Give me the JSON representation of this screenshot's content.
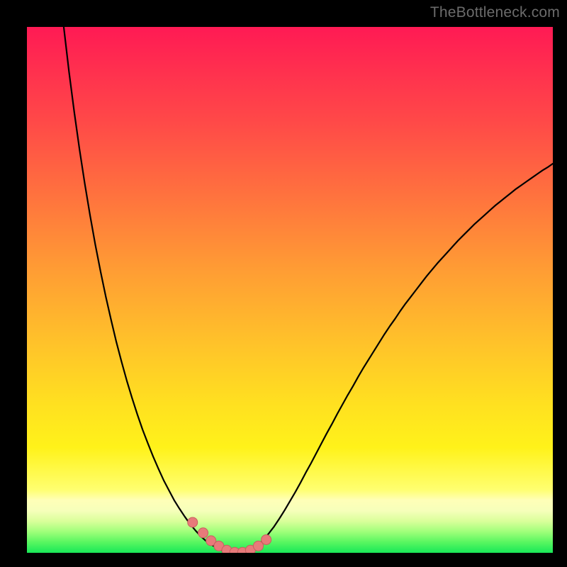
{
  "watermark": "TheBottleneck.com",
  "colors": {
    "frame": "#000000",
    "curve": "#000000",
    "marker_fill": "#e77a7a",
    "marker_stroke": "#c85f5f"
  },
  "chart_data": {
    "type": "line",
    "title": "",
    "xlabel": "",
    "ylabel": "",
    "xlim": [
      0,
      100
    ],
    "ylim": [
      0,
      100
    ],
    "grid": false,
    "x": [
      0,
      1,
      2,
      3,
      4,
      5,
      6,
      7,
      8,
      9,
      10,
      11,
      12,
      13,
      14,
      15,
      16,
      17,
      18,
      19,
      20,
      21,
      22,
      23,
      24,
      25,
      26,
      27,
      28,
      29,
      30,
      31,
      32,
      33,
      34,
      35,
      36,
      37,
      38,
      39,
      40,
      41,
      42,
      43,
      44,
      45,
      46,
      47,
      48,
      49,
      50,
      51,
      52,
      53,
      54,
      55,
      56,
      57,
      58,
      59,
      60,
      61,
      62,
      63,
      64,
      65,
      66,
      67,
      68,
      69,
      70,
      71,
      72,
      73,
      74,
      75,
      76,
      77,
      78,
      79,
      80,
      81,
      82,
      83,
      84,
      85,
      86,
      87,
      88,
      89,
      90,
      91,
      92,
      93,
      94,
      95,
      96,
      97,
      98,
      99,
      100
    ],
    "y": [
      null,
      null,
      null,
      null,
      null,
      null,
      null,
      100.0,
      91.5,
      83.8,
      76.7,
      70.2,
      64.2,
      58.6,
      53.5,
      48.7,
      44.3,
      40.1,
      36.3,
      32.7,
      29.4,
      26.3,
      23.4,
      20.8,
      18.3,
      16.0,
      13.8,
      11.9,
      10.0,
      8.4,
      6.9,
      5.5,
      4.3,
      3.2,
      2.3,
      1.6,
      1.0,
      0.5,
      0.2,
      0.05,
      0.0,
      0.05,
      0.3,
      0.8,
      1.5,
      2.5,
      3.7,
      5.0,
      6.5,
      8.1,
      9.8,
      11.5,
      13.3,
      15.2,
      17.0,
      18.9,
      20.8,
      22.7,
      24.5,
      26.4,
      28.2,
      30.0,
      31.7,
      33.5,
      35.2,
      36.8,
      38.4,
      40.0,
      41.6,
      43.1,
      44.5,
      46.0,
      47.4,
      48.7,
      50.0,
      51.3,
      52.6,
      53.8,
      55.0,
      56.1,
      57.2,
      58.3,
      59.4,
      60.4,
      61.4,
      62.4,
      63.3,
      64.2,
      65.1,
      66.0,
      66.8,
      67.6,
      68.4,
      69.2,
      69.9,
      70.6,
      71.3,
      72.0,
      72.7,
      73.3,
      74.0
    ],
    "markers": {
      "x": [
        31.5,
        33.5,
        35.0,
        36.5,
        38.0,
        39.5,
        41.0,
        42.5,
        44.0,
        45.5
      ],
      "y": [
        5.8,
        3.8,
        2.3,
        1.3,
        0.5,
        0.1,
        0.1,
        0.5,
        1.3,
        2.5
      ]
    },
    "minimum_x": 40
  }
}
